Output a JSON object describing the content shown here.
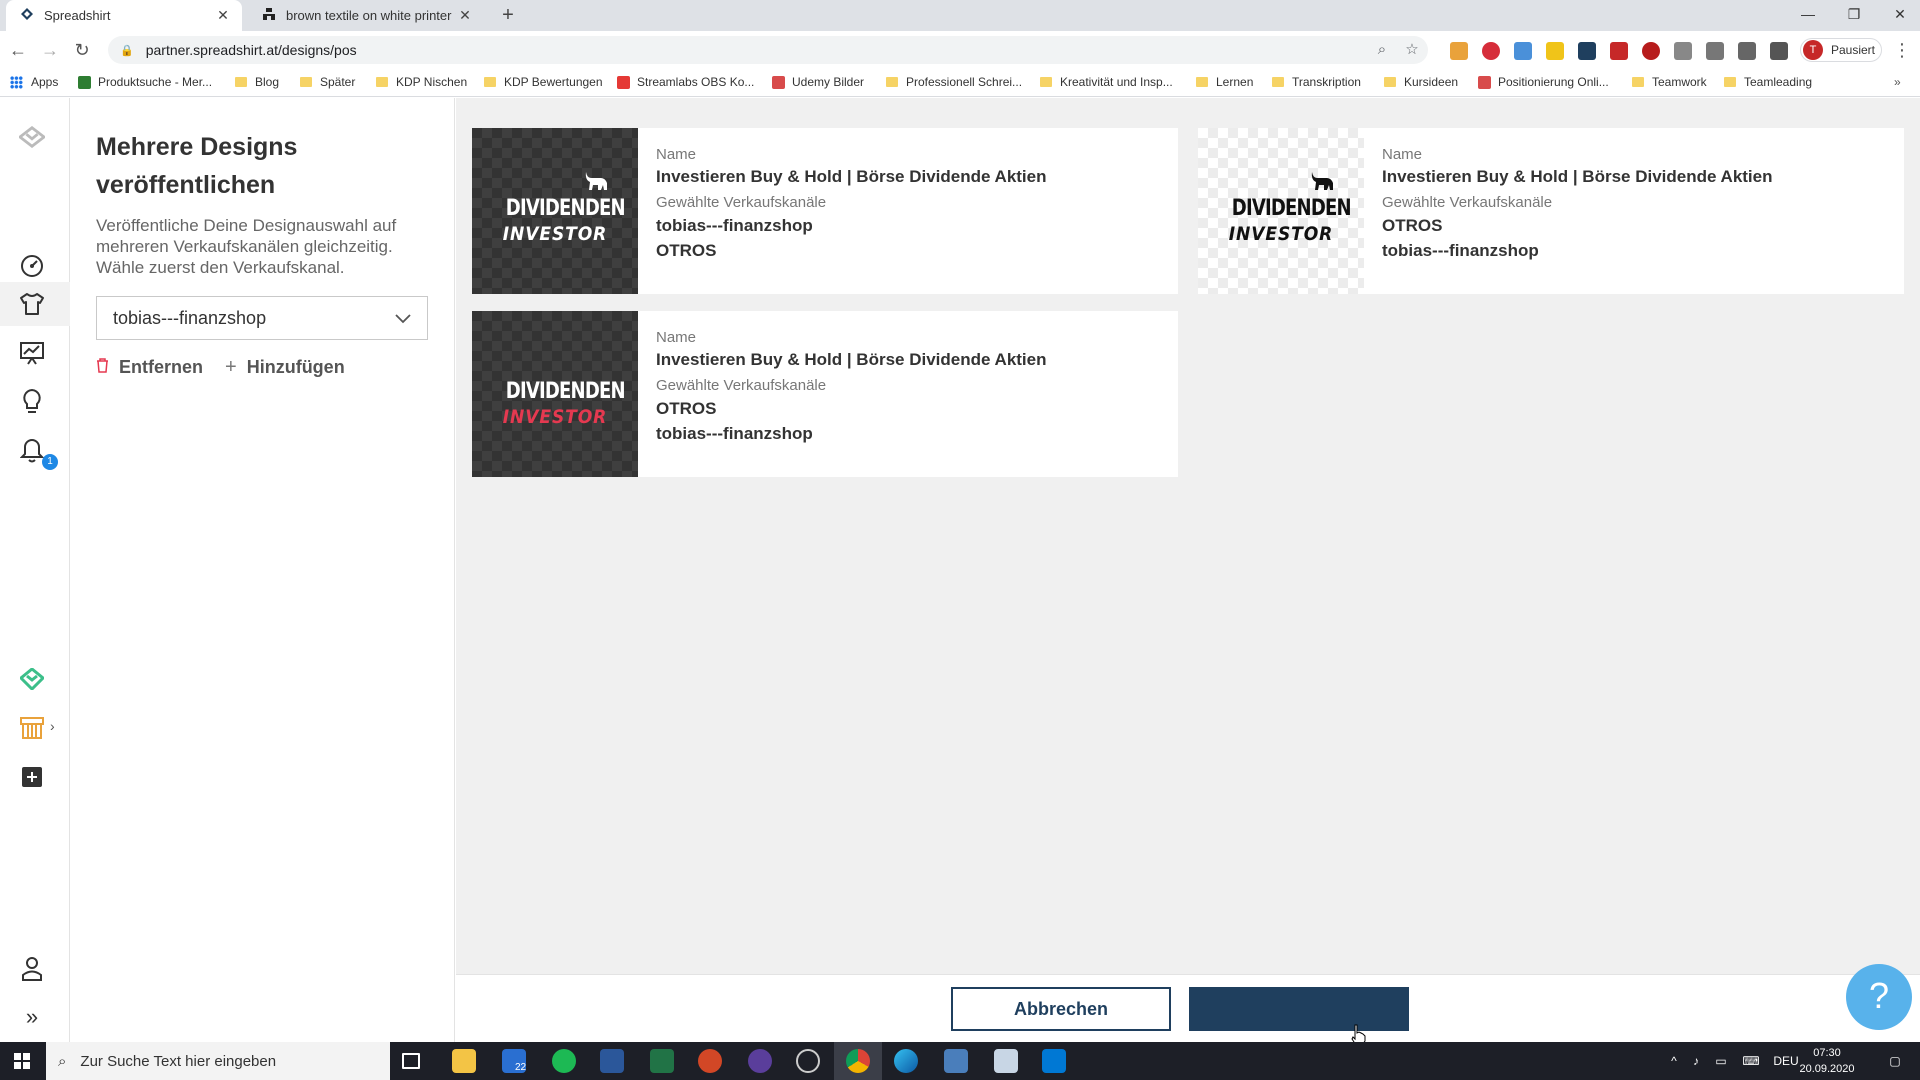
{
  "browser": {
    "tabs": [
      {
        "title": "Spreadshirt",
        "active": true
      },
      {
        "title": "brown textile on white printer pa",
        "active": false
      }
    ],
    "new_tab": "+",
    "url": "partner.spreadshirt.at/designs/pos",
    "profile_label": "Pausiert",
    "profile_initial": "T",
    "bookmarks": [
      "Apps",
      "Produktsuche - Mer...",
      "Blog",
      "Später",
      "KDP Nischen",
      "KDP Bewertungen",
      "Streamlabs OBS Ko...",
      "Udemy Bilder",
      "Professionell Schrei...",
      "Kreativität und Insp...",
      "Lernen",
      "Transkription",
      "Kursideen",
      "Positionierung Onli...",
      "Teamwork",
      "Teamleading"
    ]
  },
  "sidebar": {
    "notification_count": "1"
  },
  "panel": {
    "title": "Mehrere Designs veröffentlichen",
    "description": "Veröffentliche Deine Designauswahl auf mehreren Verkaufskanälen gleichzeitig. Wähle zuerst den Verkaufskanal.",
    "channel_select": "tobias---finanzshop",
    "remove_label": "Entfernen",
    "add_label": "Hinzufügen"
  },
  "designs": [
    {
      "name_label": "Name",
      "name": "Investieren Buy & Hold | Börse Dividende Aktien",
      "channels_label": "Gewählte Verkaufskanäle",
      "channels": [
        "tobias---finanzshop",
        "OTROS"
      ],
      "logo_line1": "DIVIDENDEN",
      "logo_line2": "INVESTOR",
      "variant": "dark"
    },
    {
      "name_label": "Name",
      "name": "Investieren Buy & Hold | Börse Dividende Aktien",
      "channels_label": "Gewählte Verkaufskanäle",
      "channels": [
        "OTROS",
        "tobias---finanzshop"
      ],
      "logo_line1": "DIVIDENDEN",
      "logo_line2": "INVESTOR",
      "variant": "light"
    },
    {
      "name_label": "Name",
      "name": "Investieren Buy & Hold | Börse Dividende Aktien",
      "channels_label": "Gewählte Verkaufskanäle",
      "channels": [
        "OTROS",
        "tobias---finanzshop"
      ],
      "logo_line1": "DIVIDENDEN",
      "logo_line2": "INVESTOR",
      "variant": "dark-red"
    }
  ],
  "footer": {
    "cancel_label": "Abbrechen",
    "primary_label": ""
  },
  "help_label": "?",
  "taskbar": {
    "search_placeholder": "Zur Suche Text hier eingeben",
    "mail_count": "22",
    "language": "DEU",
    "time": "07:30",
    "date": "20.09.2020"
  },
  "colors": {
    "primary": "#1f3f5e",
    "accent_green": "#3cbf8a",
    "help_blue": "#58b2eb",
    "logo_red": "#e53950"
  }
}
